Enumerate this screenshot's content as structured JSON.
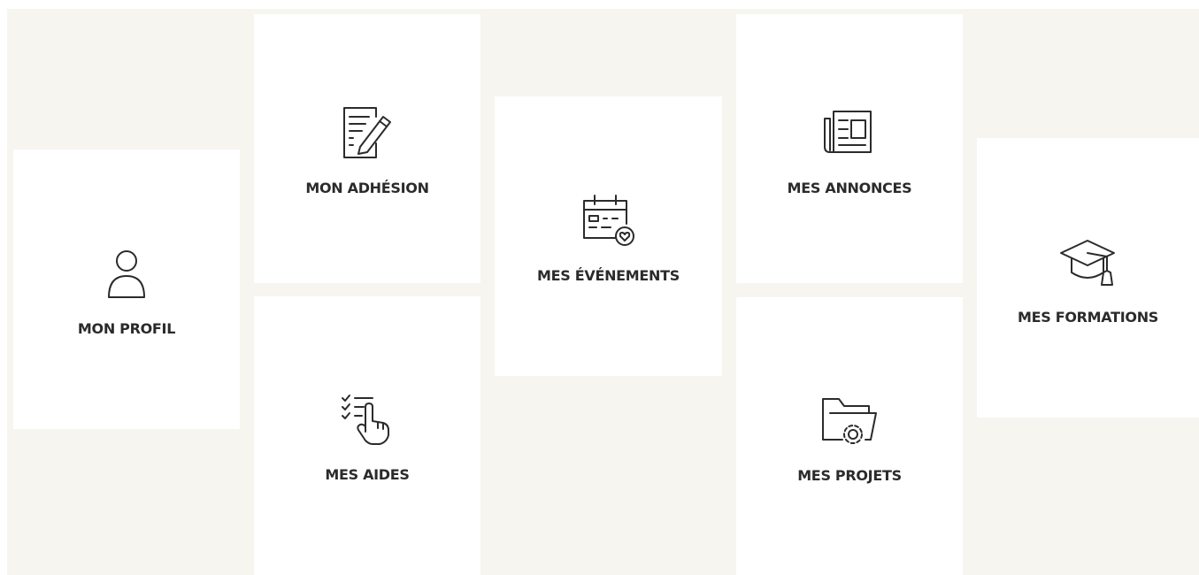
{
  "colors": {
    "background": "#f6f5ef",
    "tile": "#ffffff",
    "text": "#2b2b2b"
  },
  "tiles": [
    {
      "label": "MON PROFIL",
      "icon": "user-icon"
    },
    {
      "label": "MON ADHÉSION",
      "icon": "form-pencil-icon"
    },
    {
      "label": "MES AIDES",
      "icon": "checklist-hand-icon"
    },
    {
      "label": "MES ÉVÉNEMENTS",
      "icon": "calendar-heart-icon"
    },
    {
      "label": "MES ANNONCES",
      "icon": "newspaper-icon"
    },
    {
      "label": "MES PROJETS",
      "icon": "folder-gear-icon"
    },
    {
      "label": "MES FORMATIONS",
      "icon": "graduation-cap-icon"
    }
  ]
}
